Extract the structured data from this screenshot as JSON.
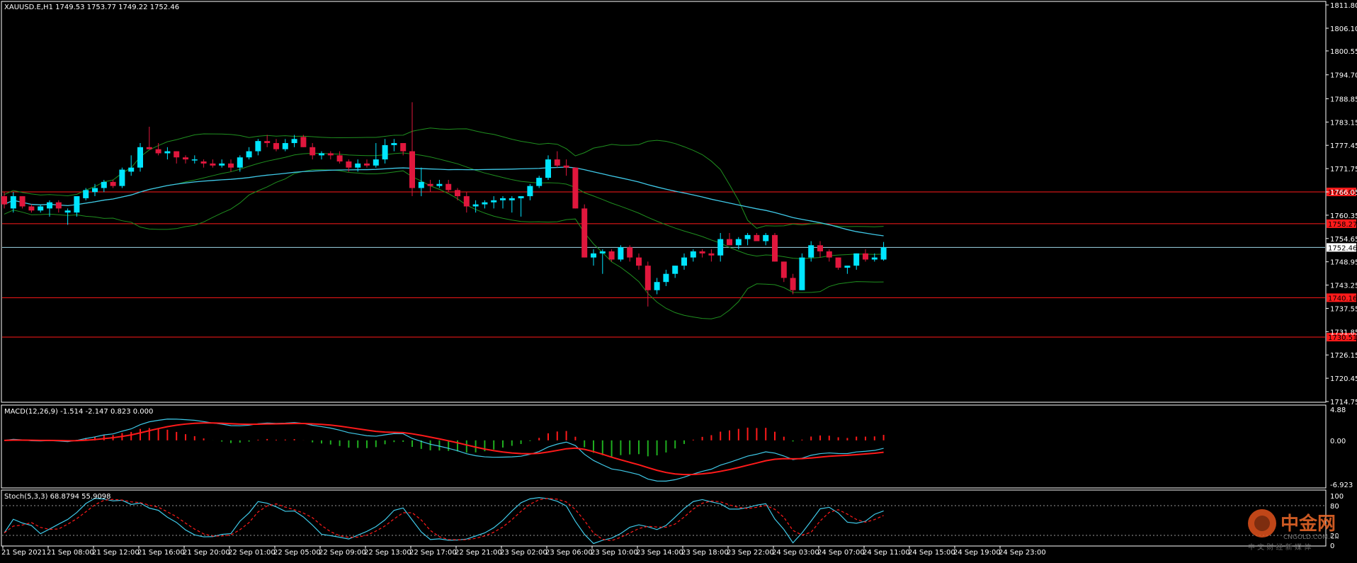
{
  "header": {
    "symbol_info": "XAUUSD.E,H1  1749.53 1753.77 1749.22 1752.46"
  },
  "colors": {
    "background": "#000000",
    "frame": "#ffffff",
    "bull_candle": "#00e5ff",
    "bear_candle": "#e0173d",
    "ma_line": "#3fc9e8",
    "bollinger": "#1f8f1f",
    "level_line": "#ff1a1a",
    "bid_line": "#9fd7e8",
    "macd_line": "#3fc9e8",
    "signal_line": "#ff1a1a",
    "hist_pos": "#ff1a1a",
    "hist_neg": "#1fae1f",
    "stoch_main": "#3fc9e8",
    "stoch_signal": "#ff1a1a"
  },
  "chart_data": [
    {
      "type": "candlestick",
      "name": "price",
      "y_ticks": [
        "1811.80",
        "1806.10",
        "1800.55",
        "1794.70",
        "1788.85",
        "1783.15",
        "1777.45",
        "1771.75",
        "1766.05",
        "1760.35",
        "1754.65",
        "1748.95",
        "1743.25",
        "1737.55",
        "1731.85",
        "1726.15",
        "1720.45",
        "1714.75"
      ],
      "ylim": [
        1714.75,
        1811.8
      ],
      "current_price": "1752.46",
      "levels": [
        {
          "value": 1766.05,
          "label": "1766.05"
        },
        {
          "value": 1758.27,
          "label": "1758.27"
        },
        {
          "value": 1740.16,
          "label": "1740.16"
        },
        {
          "value": 1730.51,
          "label": "1730.51"
        }
      ],
      "x_labels": [
        "21 Sep 2021",
        "21 Sep 08:00",
        "21 Sep 12:00",
        "21 Sep 16:00",
        "21 Sep 20:00",
        "22 Sep 01:00",
        "22 Sep 05:00",
        "22 Sep 09:00",
        "22 Sep 13:00",
        "22 Sep 17:00",
        "22 Sep 21:00",
        "23 Sep 02:00",
        "23 Sep 06:00",
        "23 Sep 10:00",
        "23 Sep 14:00",
        "23 Sep 18:00",
        "23 Sep 22:00",
        "24 Sep 03:00",
        "24 Sep 07:00",
        "24 Sep 11:00",
        "24 Sep 15:00",
        "24 Sep 19:00",
        "24 Sep 23:00"
      ],
      "ohlc": [
        [
          1765,
          1766,
          1762,
          1763
        ],
        [
          1762,
          1766,
          1761,
          1765
        ],
        [
          1765,
          1765,
          1762,
          1762.5
        ],
        [
          1762.5,
          1763,
          1761,
          1761.5
        ],
        [
          1761.5,
          1763,
          1761,
          1762.5
        ],
        [
          1762,
          1764,
          1760,
          1763.5
        ],
        [
          1763.5,
          1764,
          1761,
          1762
        ],
        [
          1761,
          1762,
          1758,
          1761.5
        ],
        [
          1761,
          1765,
          1760,
          1765
        ],
        [
          1764.5,
          1767,
          1764,
          1766.5
        ],
        [
          1766,
          1768,
          1765,
          1767
        ],
        [
          1767,
          1769,
          1766,
          1768.5
        ],
        [
          1768.5,
          1769,
          1767,
          1767.5
        ],
        [
          1767.5,
          1772,
          1767,
          1771.5
        ],
        [
          1771,
          1775,
          1770,
          1772
        ],
        [
          1772,
          1778,
          1771,
          1777
        ],
        [
          1777,
          1782,
          1777,
          1776.5
        ],
        [
          1776.5,
          1778,
          1775,
          1775.5
        ],
        [
          1775.5,
          1777,
          1774,
          1776
        ],
        [
          1776,
          1776,
          1773,
          1774.5
        ],
        [
          1774.5,
          1775,
          1773,
          1774
        ],
        [
          1774,
          1775,
          1773,
          1774
        ],
        [
          1773.5,
          1774,
          1772,
          1773
        ],
        [
          1773,
          1774,
          1772,
          1772.5
        ],
        [
          1772.5,
          1774,
          1772,
          1773
        ],
        [
          1773,
          1774,
          1771,
          1772
        ],
        [
          1772,
          1775,
          1771,
          1774.5
        ],
        [
          1774.5,
          1777,
          1774,
          1776
        ],
        [
          1776,
          1779,
          1775,
          1778.5
        ],
        [
          1778.5,
          1780,
          1777,
          1778
        ],
        [
          1778,
          1779,
          1776,
          1776.5
        ],
        [
          1776.5,
          1779,
          1776,
          1778
        ],
        [
          1778,
          1780,
          1777,
          1779
        ],
        [
          1779.5,
          1780,
          1777,
          1777
        ],
        [
          1777,
          1778,
          1774,
          1775
        ],
        [
          1775,
          1776,
          1774,
          1775.5
        ],
        [
          1775.5,
          1776,
          1774,
          1775
        ],
        [
          1775,
          1776,
          1773,
          1773.5
        ],
        [
          1773.5,
          1774,
          1771,
          1772
        ],
        [
          1772,
          1774,
          1771,
          1773
        ],
        [
          1773,
          1774,
          1772,
          1772.5
        ],
        [
          1772.5,
          1778,
          1772,
          1774
        ],
        [
          1774,
          1779,
          1773,
          1777.5
        ],
        [
          1777.5,
          1779,
          1776,
          1778
        ],
        [
          1778,
          1778,
          1775,
          1776
        ],
        [
          1776,
          1788,
          1765,
          1767
        ],
        [
          1767,
          1772,
          1765,
          1768.5
        ],
        [
          1768,
          1769,
          1766,
          1767.5
        ],
        [
          1767.5,
          1769,
          1767,
          1768
        ],
        [
          1768,
          1769,
          1766,
          1766.5
        ],
        [
          1766.5,
          1767,
          1764,
          1765
        ],
        [
          1765,
          1766,
          1761,
          1762.5
        ],
        [
          1762.5,
          1764,
          1761,
          1763
        ],
        [
          1763,
          1764,
          1762,
          1763.5
        ],
        [
          1763.5,
          1765,
          1762,
          1764
        ],
        [
          1764,
          1765,
          1762,
          1764.5
        ],
        [
          1764,
          1765,
          1761,
          1764.5
        ],
        [
          1764.5,
          1765,
          1760,
          1765
        ],
        [
          1765,
          1768,
          1764,
          1767.5
        ],
        [
          1767.5,
          1770,
          1767,
          1769.5
        ],
        [
          1769.5,
          1775,
          1769,
          1774
        ],
        [
          1774,
          1776,
          1772,
          1772.5
        ],
        [
          1772.5,
          1774,
          1770,
          1772
        ],
        [
          1772,
          1772,
          1762,
          1762
        ],
        [
          1762,
          1763,
          1750,
          1750
        ],
        [
          1750,
          1752,
          1748,
          1751
        ],
        [
          1751,
          1752,
          1746,
          1751.5
        ],
        [
          1751.5,
          1752,
          1749,
          1749.5
        ],
        [
          1749.5,
          1753,
          1749,
          1752.5
        ],
        [
          1752.5,
          1753,
          1749,
          1750
        ],
        [
          1750,
          1751,
          1747,
          1748
        ],
        [
          1748,
          1749,
          1738,
          1742
        ],
        [
          1742,
          1745,
          1741,
          1744
        ],
        [
          1744,
          1747,
          1743,
          1746
        ],
        [
          1746,
          1748,
          1745,
          1748
        ],
        [
          1748,
          1751,
          1747,
          1750
        ],
        [
          1750,
          1752,
          1749,
          1751.5
        ],
        [
          1751.5,
          1752,
          1750,
          1751
        ],
        [
          1751,
          1752,
          1749,
          1750.5
        ],
        [
          1750.5,
          1756,
          1749,
          1754.5
        ],
        [
          1754.5,
          1756,
          1753,
          1753
        ],
        [
          1753,
          1755,
          1752,
          1754.5
        ],
        [
          1754.5,
          1756,
          1753,
          1755.5
        ],
        [
          1755.5,
          1756,
          1754,
          1754
        ],
        [
          1754,
          1756,
          1753,
          1755.5
        ],
        [
          1755.5,
          1756,
          1749,
          1749
        ],
        [
          1749,
          1749,
          1744,
          1745
        ],
        [
          1745,
          1746,
          1741,
          1742
        ],
        [
          1742,
          1751,
          1742,
          1750
        ],
        [
          1750,
          1754,
          1749,
          1753
        ],
        [
          1753,
          1754,
          1750,
          1751.5
        ],
        [
          1751.5,
          1752,
          1749,
          1750
        ],
        [
          1750,
          1750,
          1747,
          1747.5
        ],
        [
          1747.5,
          1748,
          1746,
          1748
        ],
        [
          1748,
          1751,
          1747,
          1751
        ],
        [
          1751,
          1752,
          1749,
          1749.5
        ],
        [
          1749.5,
          1751,
          1749,
          1750
        ],
        [
          1749.5,
          1753.8,
          1749.2,
          1752.5
        ]
      ]
    },
    {
      "type": "line",
      "name": "MACD(12,26,9) -1.514 -2.147 0.823 0.000",
      "y_ticks": [
        "4.88",
        "0.00",
        "-6.923"
      ],
      "ylim": [
        -6.923,
        4.88
      ]
    },
    {
      "type": "line",
      "name": "Stoch(5,3,3) 68.8794 55.9098",
      "y_ticks": [
        "100",
        "80",
        "20",
        "0"
      ],
      "ylim": [
        0,
        100
      ]
    }
  ],
  "watermark": {
    "brand": "中金网",
    "domain": "CNGOLD.COM.CN",
    "slogan": "中 文 财 经 新 媒 体"
  }
}
